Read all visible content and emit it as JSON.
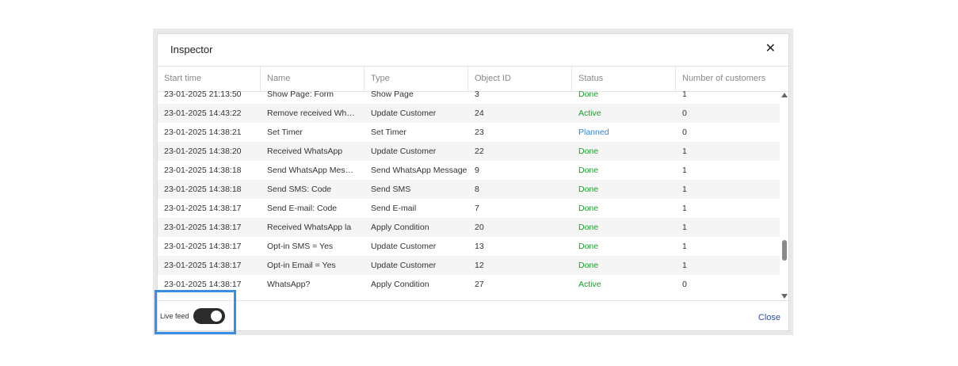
{
  "dialog": {
    "title": "Inspector",
    "close_icon": "close-icon"
  },
  "table": {
    "columns": [
      "Start time",
      "Name",
      "Type",
      "Object ID",
      "Status",
      "Number of customers"
    ],
    "rows": [
      [
        "23-01-2025 21:13:50",
        "Show Page: Form",
        "Show Page",
        "3",
        "Done",
        "1"
      ],
      [
        "23-01-2025 14:43:22",
        "Remove received WhatsApp",
        "Update Customer",
        "24",
        "Active",
        "0"
      ],
      [
        "23-01-2025 14:38:21",
        "Set Timer",
        "Set Timer",
        "23",
        "Planned",
        "0"
      ],
      [
        "23-01-2025 14:38:20",
        "Received WhatsApp",
        "Update Customer",
        "22",
        "Done",
        "1"
      ],
      [
        "23-01-2025 14:38:18",
        "Send WhatsApp Message",
        "Send WhatsApp Message",
        "9",
        "Done",
        "1"
      ],
      [
        "23-01-2025 14:38:18",
        "Send SMS: Code",
        "Send SMS",
        "8",
        "Done",
        "1"
      ],
      [
        "23-01-2025 14:38:17",
        "Send E-mail: Code",
        "Send E-mail",
        "7",
        "Done",
        "1"
      ],
      [
        "23-01-2025 14:38:17",
        "Received WhatsApp la",
        "Apply Condition",
        "20",
        "Done",
        "1"
      ],
      [
        "23-01-2025 14:38:17",
        "Opt-in SMS = Yes",
        "Update Customer",
        "13",
        "Done",
        "1"
      ],
      [
        "23-01-2025 14:38:17",
        "Opt-in Email = Yes",
        "Update Customer",
        "12",
        "Done",
        "1"
      ],
      [
        "23-01-2025 14:38:17",
        "WhatsApp?",
        "Apply Condition",
        "27",
        "Active",
        "0"
      ]
    ]
  },
  "footer": {
    "live_feed_label": "Live feed",
    "live_feed_on": true,
    "close_label": "Close"
  },
  "colors": {
    "done": "#1c9c2c",
    "active": "#1c9c2c",
    "planned": "#2a87d8",
    "highlight": "#3a8ee6"
  }
}
